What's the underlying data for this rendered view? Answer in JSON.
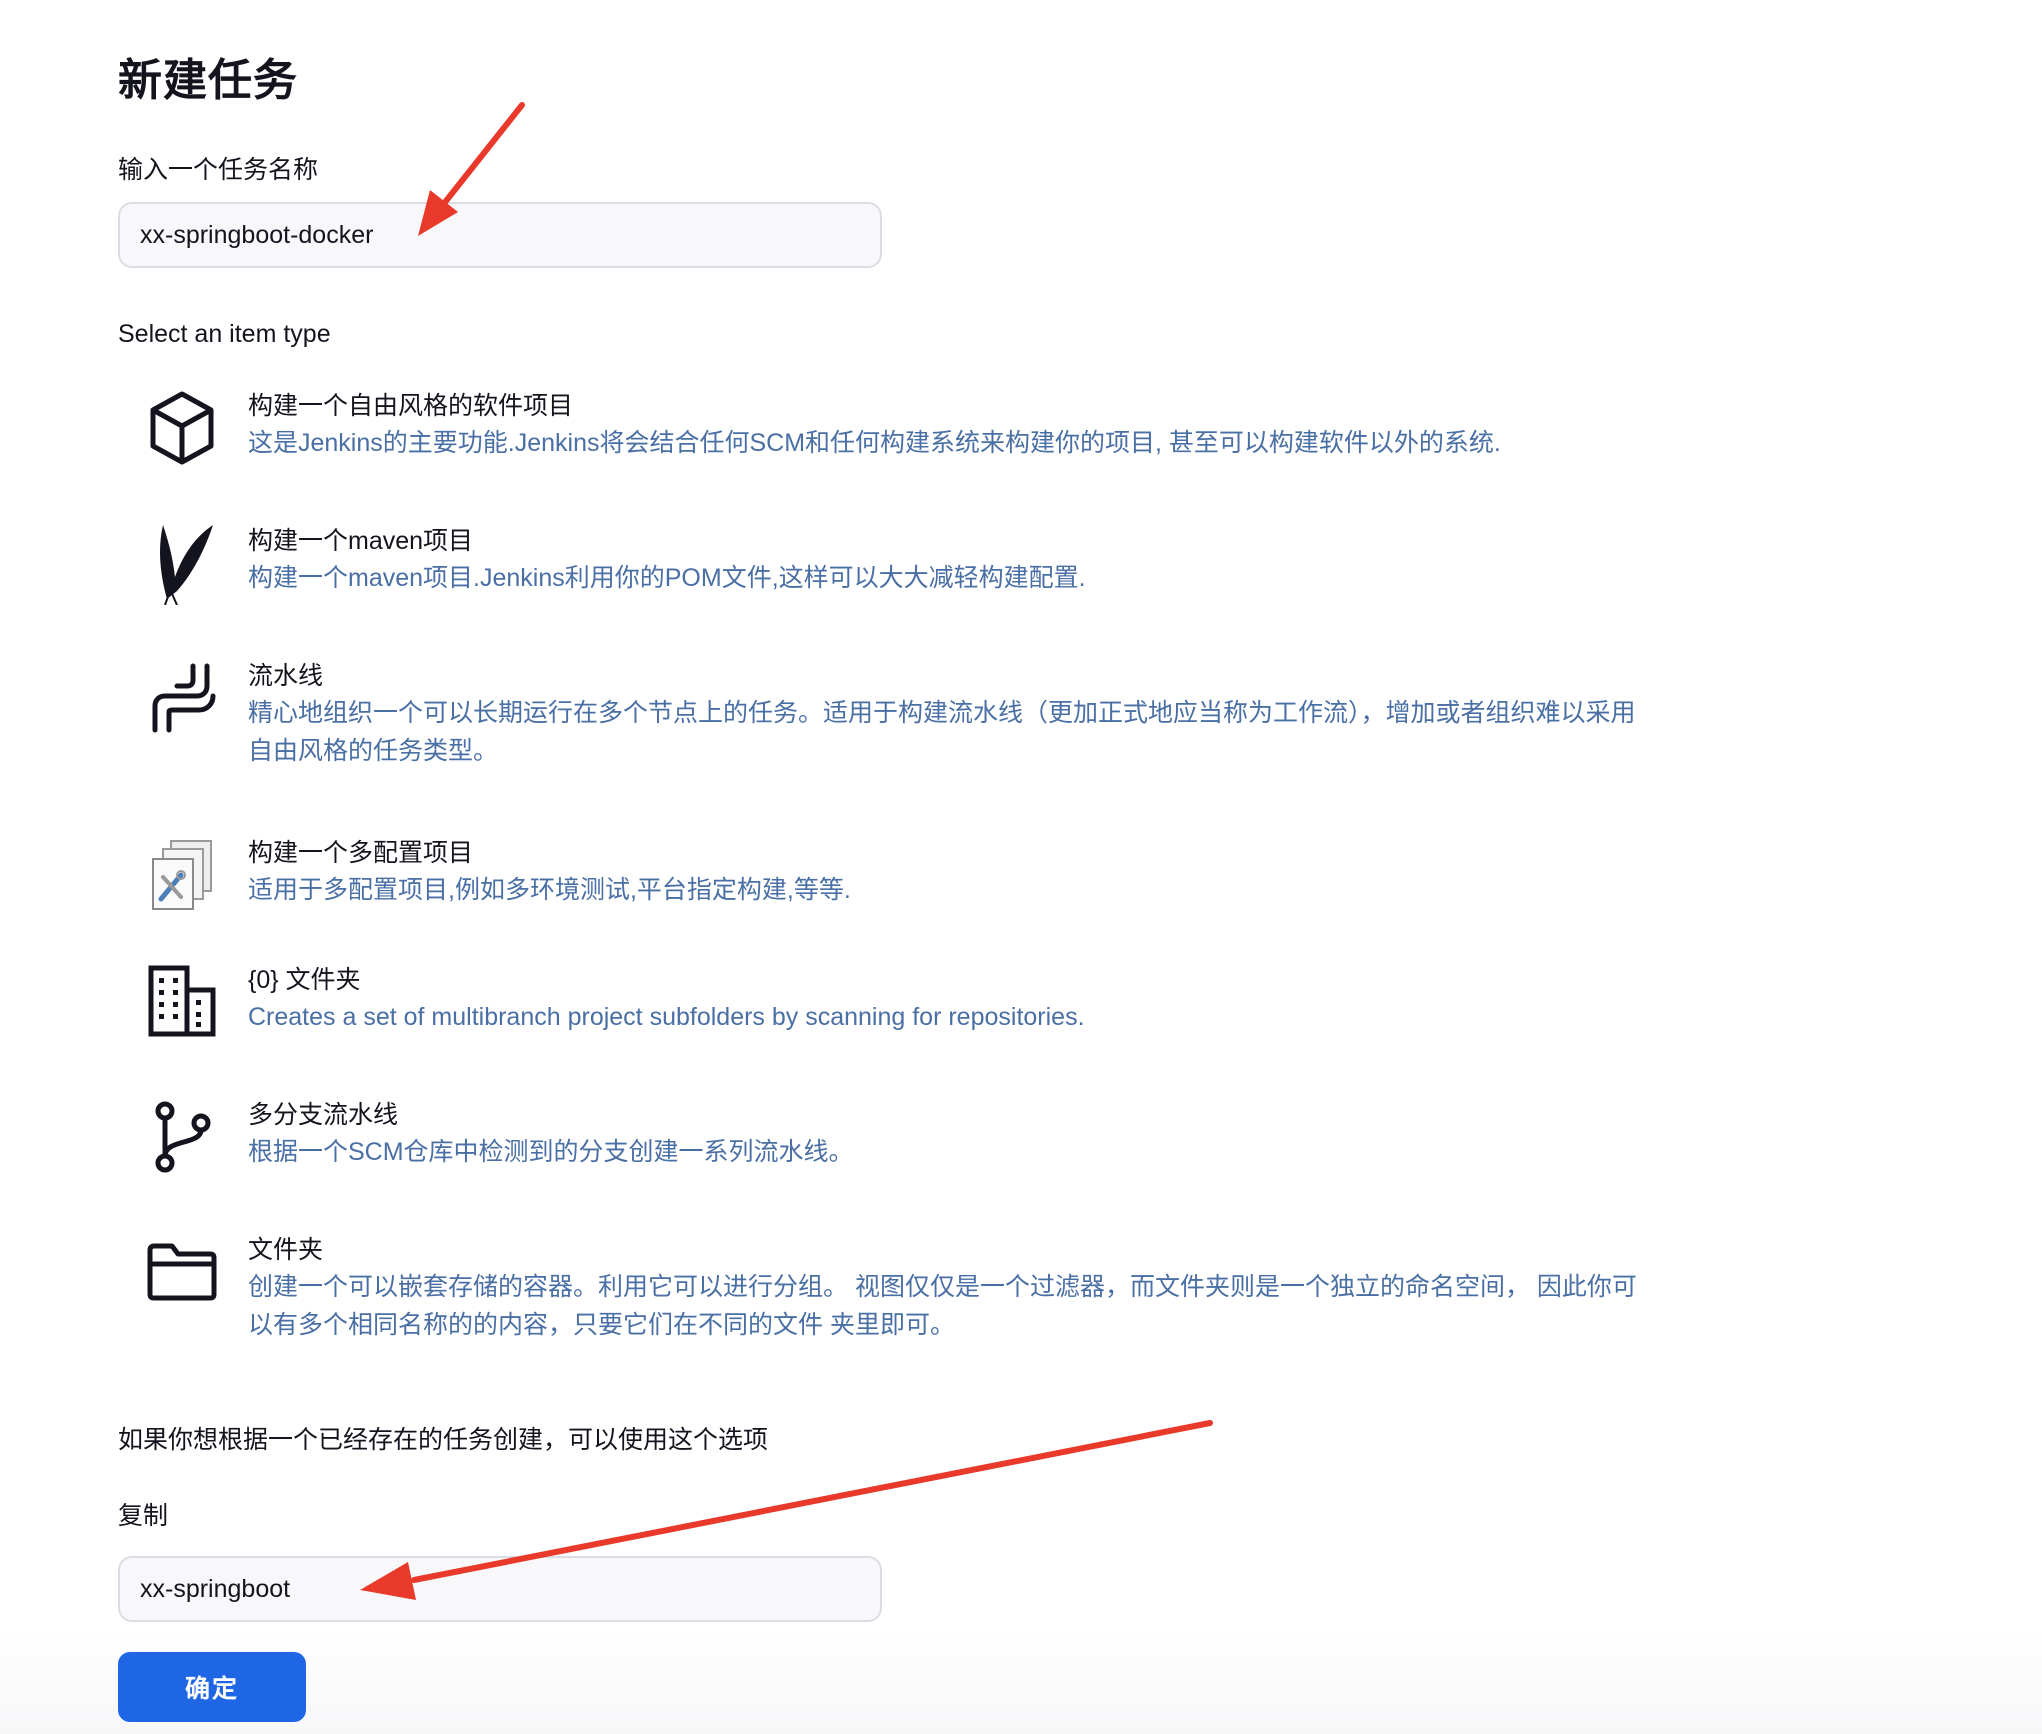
{
  "page": {
    "title": "新建任务",
    "name_label": "输入一个任务名称",
    "name_value": "xx-springboot-docker",
    "select_label": "Select an item type"
  },
  "items": [
    {
      "icon": "cube-icon",
      "name": "构建一个自由风格的软件项目",
      "desc": "这是Jenkins的主要功能.Jenkins将会结合任何SCM和任何构建系统来构建你的项目, 甚至可以构建软件以外的系统."
    },
    {
      "icon": "feather-icon",
      "name": "构建一个maven项目",
      "desc": "构建一个maven项目.Jenkins利用你的POM文件,这样可以大大减轻构建配置."
    },
    {
      "icon": "pipeline-icon",
      "name": "流水线",
      "desc": "精心地组织一个可以长期运行在多个节点上的任务。适用于构建流水线（更加正式地应当称为工作流），增加或者组织难以采用自由风格的任务类型。"
    },
    {
      "icon": "multi-config-icon",
      "name": "构建一个多配置项目",
      "desc": "适用于多配置项目,例如多环境测试,平台指定构建,等等."
    },
    {
      "icon": "building-icon",
      "name": "{0} 文件夹",
      "desc": "Creates a set of multibranch project subfolders by scanning for repositories."
    },
    {
      "icon": "branch-icon",
      "name": "多分支流水线",
      "desc": "根据一个SCM仓库中检测到的分支创建一系列流水线。"
    },
    {
      "icon": "folder-icon",
      "name": "文件夹",
      "desc": "创建一个可以嵌套存储的容器。利用它可以进行分组。 视图仅仅是一个过滤器，而文件夹则是一个独立的命名空间， 因此你可以有多个相同名称的的内容，只要它们在不同的文件 夹里即可。"
    }
  ],
  "copy": {
    "hint": "如果你想根据一个已经存在的任务创建，可以使用这个选项",
    "label": "复制",
    "value": "xx-springboot"
  },
  "actions": {
    "ok_label": "确定"
  },
  "colors": {
    "accent": "#1f66e5",
    "description_text": "#4a6fa5",
    "annotation_arrow": "#e8392a"
  }
}
